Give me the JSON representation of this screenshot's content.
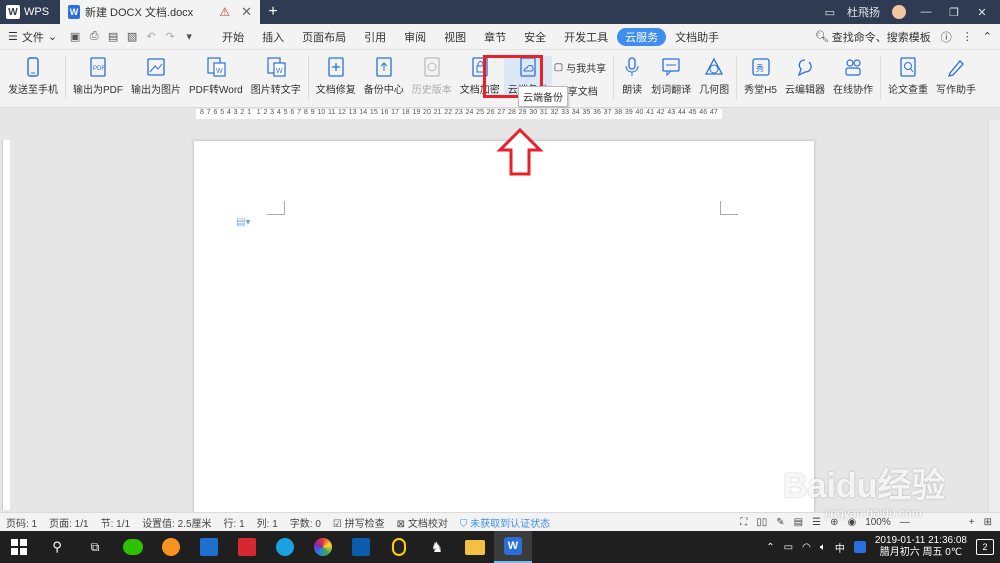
{
  "titlebar": {
    "app_name": "WPS",
    "doc_tab": "新建 DOCX 文档.docx",
    "user_name": "杜飛扬"
  },
  "menubar": {
    "file_label": "文件",
    "tabs": [
      "开始",
      "插入",
      "页面布局",
      "引用",
      "审阅",
      "视图",
      "章节",
      "安全",
      "开发工具",
      "云服务",
      "文档助手"
    ],
    "active_tab": "云服务",
    "search_label": "查找命令、搜索模板"
  },
  "ribbon": {
    "send_phone": "发送至手机",
    "to_pdf": "输出为PDF",
    "to_image": "输出为图片",
    "pdf_word": "PDF转Word",
    "img_text": "图片转文字",
    "doc_repair": "文档修复",
    "backup_center": "备份中心",
    "history": "历史版本",
    "doc_encrypt": "文档加密",
    "cloud_backup": "云端备份",
    "share_with_me": "与我共享",
    "share_doc": "享文档",
    "read_aloud": "朗读",
    "translate": "划词翻译",
    "geometry": "几何图",
    "show_h5": "秀堂H5",
    "cloud_editor": "云编辑器",
    "collab": "在线协作",
    "plagiarism": "论文查重",
    "writing": "写作助手"
  },
  "tooltip": "云端备份",
  "ruler_ticks": [
    "8",
    "7",
    "6",
    "5",
    "4",
    "3",
    "2",
    "1",
    "",
    "1",
    "2",
    "3",
    "4",
    "5",
    "6",
    "7",
    "8",
    "9",
    "10",
    "11",
    "12",
    "13",
    "14",
    "15",
    "16",
    "17",
    "18",
    "19",
    "20",
    "21",
    "22",
    "23",
    "24",
    "25",
    "26",
    "27",
    "28",
    "29",
    "30",
    "31",
    "32",
    "33",
    "34",
    "35",
    "36",
    "37",
    "38",
    "39",
    "40",
    "41",
    "42",
    "43",
    "44",
    "45",
    "46",
    "47"
  ],
  "status": {
    "page_no": "页码: 1",
    "pages": "页面: 1/1",
    "section": "节: 1/1",
    "setting": "设置值: 2.5厘米",
    "row": "行: 1",
    "col": "列: 1",
    "words": "字数: 0",
    "spell": "拼写检查",
    "proof": "文档校对",
    "cert": "未获取到认证状态",
    "zoom": "100%"
  },
  "taskbar": {
    "ime": "中",
    "date": "2019-01-11",
    "time": "21:36:08",
    "lunar": "腊月初六 周五 0℃",
    "notif_count": "2"
  },
  "watermark": {
    "brand": "Baidu经验",
    "url": "jingyan.baidu.com"
  }
}
